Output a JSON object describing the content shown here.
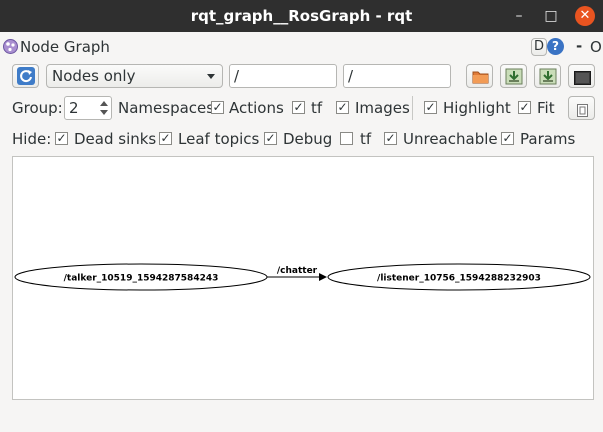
{
  "window": {
    "title": "rqt_graph__RosGraph - rqt",
    "minimize": "–",
    "maximize": "□",
    "close": "✕"
  },
  "panel": {
    "title": "Node Graph",
    "d_label": "D",
    "help_label": "?",
    "dash_label": "-",
    "o_label": "O"
  },
  "toolbar": {
    "mode_value": "Nodes only",
    "node_filter": "/",
    "topic_filter": "/"
  },
  "options": {
    "group_label": "Group:",
    "group_value": "2",
    "namespaces_label": "Namespaces",
    "actions_label": "Actions",
    "tf_label": "tf",
    "images_label": "Images",
    "highlight_label": "Highlight",
    "fit_label": "Fit"
  },
  "hide": {
    "label": "Hide:",
    "dead_sinks": "Dead sinks",
    "leaf_topics": "Leaf topics",
    "debug": "Debug",
    "tf": "tf",
    "unreachable": "Unreachable",
    "params": "Params"
  },
  "graph": {
    "talker": "/talker_10519_1594287584243",
    "listener": "/listener_10756_1594288232903",
    "edge": "/chatter"
  },
  "colors": {
    "titlebar": "#2f2f2f",
    "close": "#e95420",
    "help": "#3a73c4"
  }
}
